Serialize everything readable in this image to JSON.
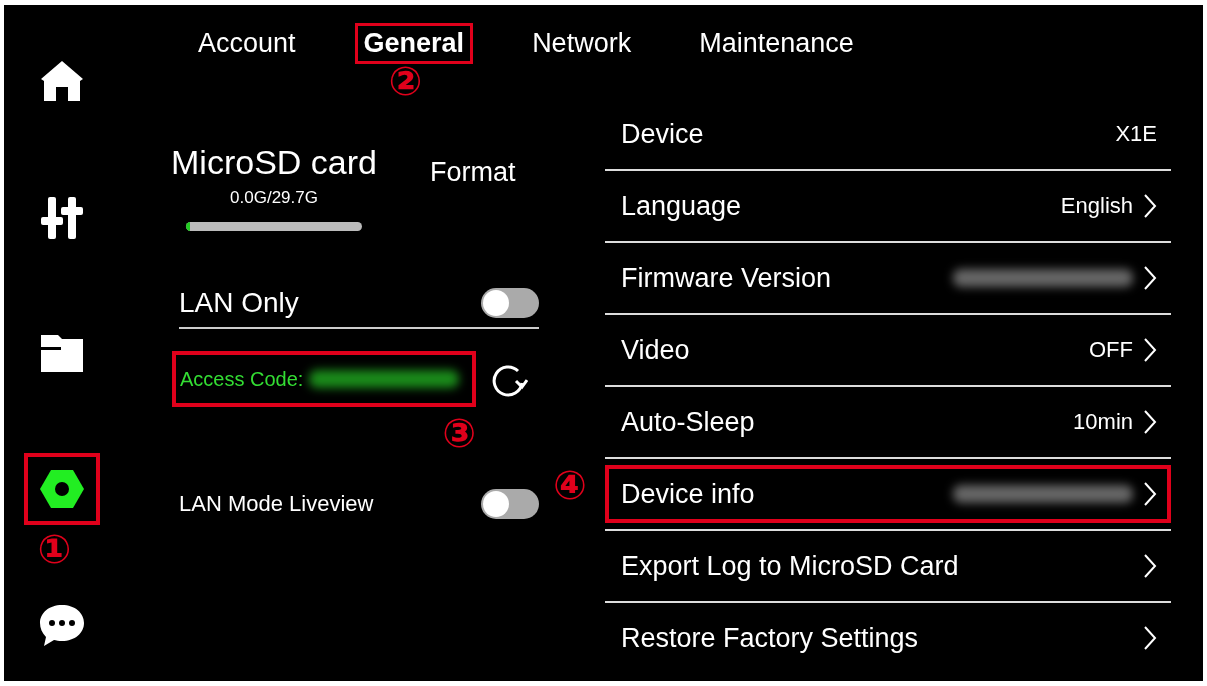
{
  "sidebar": {
    "items": [
      {
        "kind": "home",
        "selected": false,
        "highlighted": false
      },
      {
        "kind": "sliders",
        "selected": false,
        "highlighted": false
      },
      {
        "kind": "folder",
        "selected": false,
        "highlighted": false
      },
      {
        "kind": "settings",
        "selected": true,
        "highlighted": true,
        "callout": "①"
      },
      {
        "kind": "chat",
        "selected": false,
        "highlighted": false
      }
    ]
  },
  "tabs": [
    {
      "label": "Account",
      "selected": false,
      "highlighted": false
    },
    {
      "label": "General",
      "selected": true,
      "highlighted": true,
      "callout": "②"
    },
    {
      "label": "Network",
      "selected": false,
      "highlighted": false
    },
    {
      "label": "Maintenance",
      "selected": false,
      "highlighted": false
    }
  ],
  "storage": {
    "title": "MicroSD card",
    "usage": "0.0G/29.7G",
    "level": 0.02,
    "action": "Format"
  },
  "lan_only": {
    "label": "LAN Only",
    "on": false
  },
  "access_code": {
    "label": "Access Code:",
    "redacted": true,
    "highlighted": true,
    "callout": "③"
  },
  "liveview": {
    "label": "LAN Mode Liveview",
    "on": false
  },
  "settings": [
    {
      "label": "Device",
      "value": "X1E",
      "redacted": false,
      "chevron": false,
      "highlighted": false
    },
    {
      "label": "Language",
      "value": "English",
      "redacted": false,
      "chevron": true,
      "highlighted": false
    },
    {
      "label": "Firmware Version",
      "redacted": true,
      "chevron": true,
      "highlighted": false
    },
    {
      "label": "Video",
      "value": "OFF",
      "redacted": false,
      "chevron": true,
      "highlighted": false
    },
    {
      "label": "Auto-Sleep",
      "value": "10min",
      "redacted": false,
      "chevron": true,
      "highlighted": false
    },
    {
      "label": "Device info",
      "redacted": true,
      "chevron": true,
      "highlighted": true,
      "callout": "④"
    },
    {
      "label": "Export Log to MicroSD Card",
      "redacted": false,
      "chevron": true,
      "highlighted": false
    },
    {
      "label": "Restore Factory Settings",
      "redacted": false,
      "chevron": true,
      "highlighted": false
    }
  ]
}
